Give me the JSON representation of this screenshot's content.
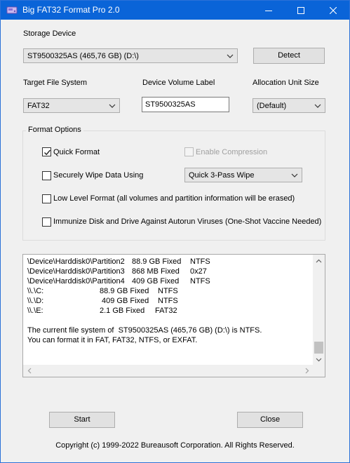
{
  "window": {
    "title": "Big FAT32 Format Pro 2.0"
  },
  "storage": {
    "label": "Storage Device",
    "device": "ST9500325AS (465,76 GB) (D:\\)",
    "detect_label": "Detect"
  },
  "target_fs": {
    "label": "Target File System",
    "value": "FAT32"
  },
  "volume_label": {
    "label": "Device Volume Label",
    "value": "ST9500325AS"
  },
  "alloc": {
    "label": "Allocation Unit Size",
    "value": "(Default)"
  },
  "options": {
    "title": "Format Options",
    "quick_format": {
      "label": "Quick Format",
      "checked": true
    },
    "enable_compression": {
      "label": "Enable Compression",
      "checked": false,
      "enabled": false
    },
    "secure_wipe": {
      "label": "Securely Wipe Data Using",
      "checked": false
    },
    "wipe_method": "Quick 3-Pass Wipe",
    "low_level": {
      "label": "Low Level Format (all volumes and partition information will be erased)",
      "checked": false
    },
    "immunize": {
      "label": "Immunize Disk and Drive Against Autorun Viruses (One-Shot Vaccine Needed)",
      "checked": false
    }
  },
  "log": {
    "rows": [
      {
        "name": "\\Device\\Harddisk0\\Partition2",
        "size": "88.9 GB Fixed",
        "fs": "NTFS"
      },
      {
        "name": "\\Device\\Harddisk0\\Partition3",
        "size": "868 MB Fixed",
        "fs": "0x27"
      },
      {
        "name": "\\Device\\Harddisk0\\Partition4",
        "size": "409 GB Fixed",
        "fs": "NTFS"
      },
      {
        "name": "\\\\.\\C:",
        "size": "88.9 GB Fixed",
        "fs": "NTFS"
      },
      {
        "name": "\\\\.\\D:",
        "size": "409 GB Fixed",
        "fs": "NTFS"
      },
      {
        "name": "\\\\.\\E:",
        "size": "2.1 GB Fixed",
        "fs": "FAT32"
      }
    ],
    "message1": "The current file system of  ST9500325AS (465,76 GB) (D:\\) is NTFS.",
    "message2": "You can format it in FAT, FAT32, NTFS, or EXFAT."
  },
  "actions": {
    "start_label": "Start",
    "close_label": "Close"
  },
  "footer": {
    "copyright": "Copyright (c) 1999-2022 Bureausoft Corporation. All Rights Reserved."
  }
}
